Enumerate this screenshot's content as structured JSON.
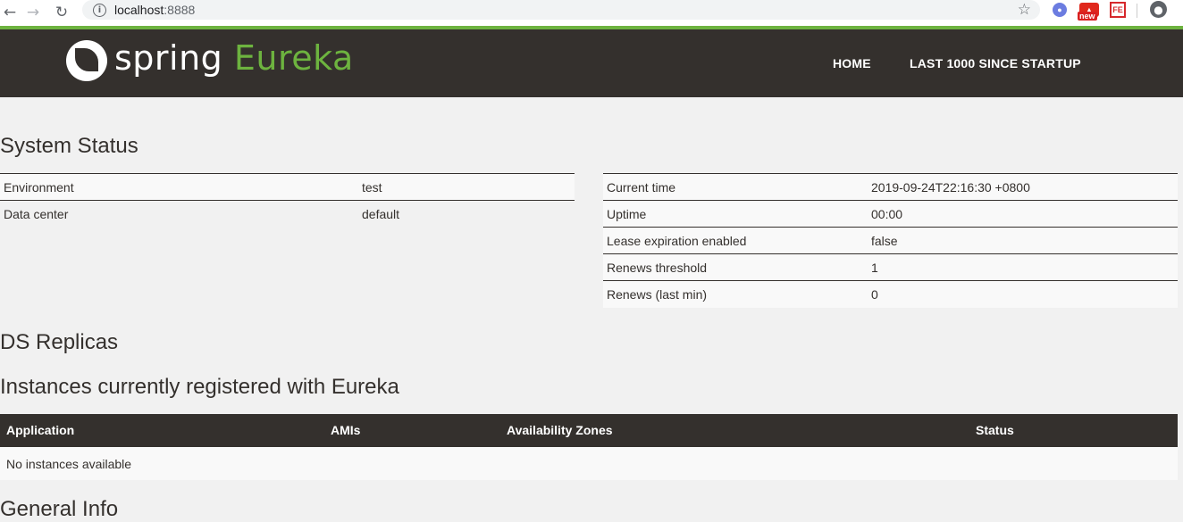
{
  "browser": {
    "url_host": "localhost",
    "url_port": ":8888",
    "ext_new_badge": "new",
    "ext_fe_label": "FE"
  },
  "navbar": {
    "logo_spring": "spring",
    "logo_eureka": "Eureka",
    "links": [
      "HOME",
      "LAST 1000 SINCE STARTUP"
    ]
  },
  "system_status": {
    "title": "System Status",
    "left": [
      {
        "key": "Environment",
        "value": "test"
      },
      {
        "key": "Data center",
        "value": "default"
      }
    ],
    "right": [
      {
        "key": "Current time",
        "value": "2019-09-24T22:16:30 +0800"
      },
      {
        "key": "Uptime",
        "value": "00:00"
      },
      {
        "key": "Lease expiration enabled",
        "value": "false"
      },
      {
        "key": "Renews threshold",
        "value": "1"
      },
      {
        "key": "Renews (last min)",
        "value": "0"
      }
    ]
  },
  "ds_replicas": {
    "title": "DS Replicas"
  },
  "instances": {
    "title": "Instances currently registered with Eureka",
    "columns": [
      "Application",
      "AMIs",
      "Availability Zones",
      "Status"
    ],
    "empty_text": "No instances available"
  },
  "general_info": {
    "title": "General Info"
  },
  "colors": {
    "navbar": "#34302d",
    "accent": "#6db33f",
    "background": "#f1f1f1"
  }
}
